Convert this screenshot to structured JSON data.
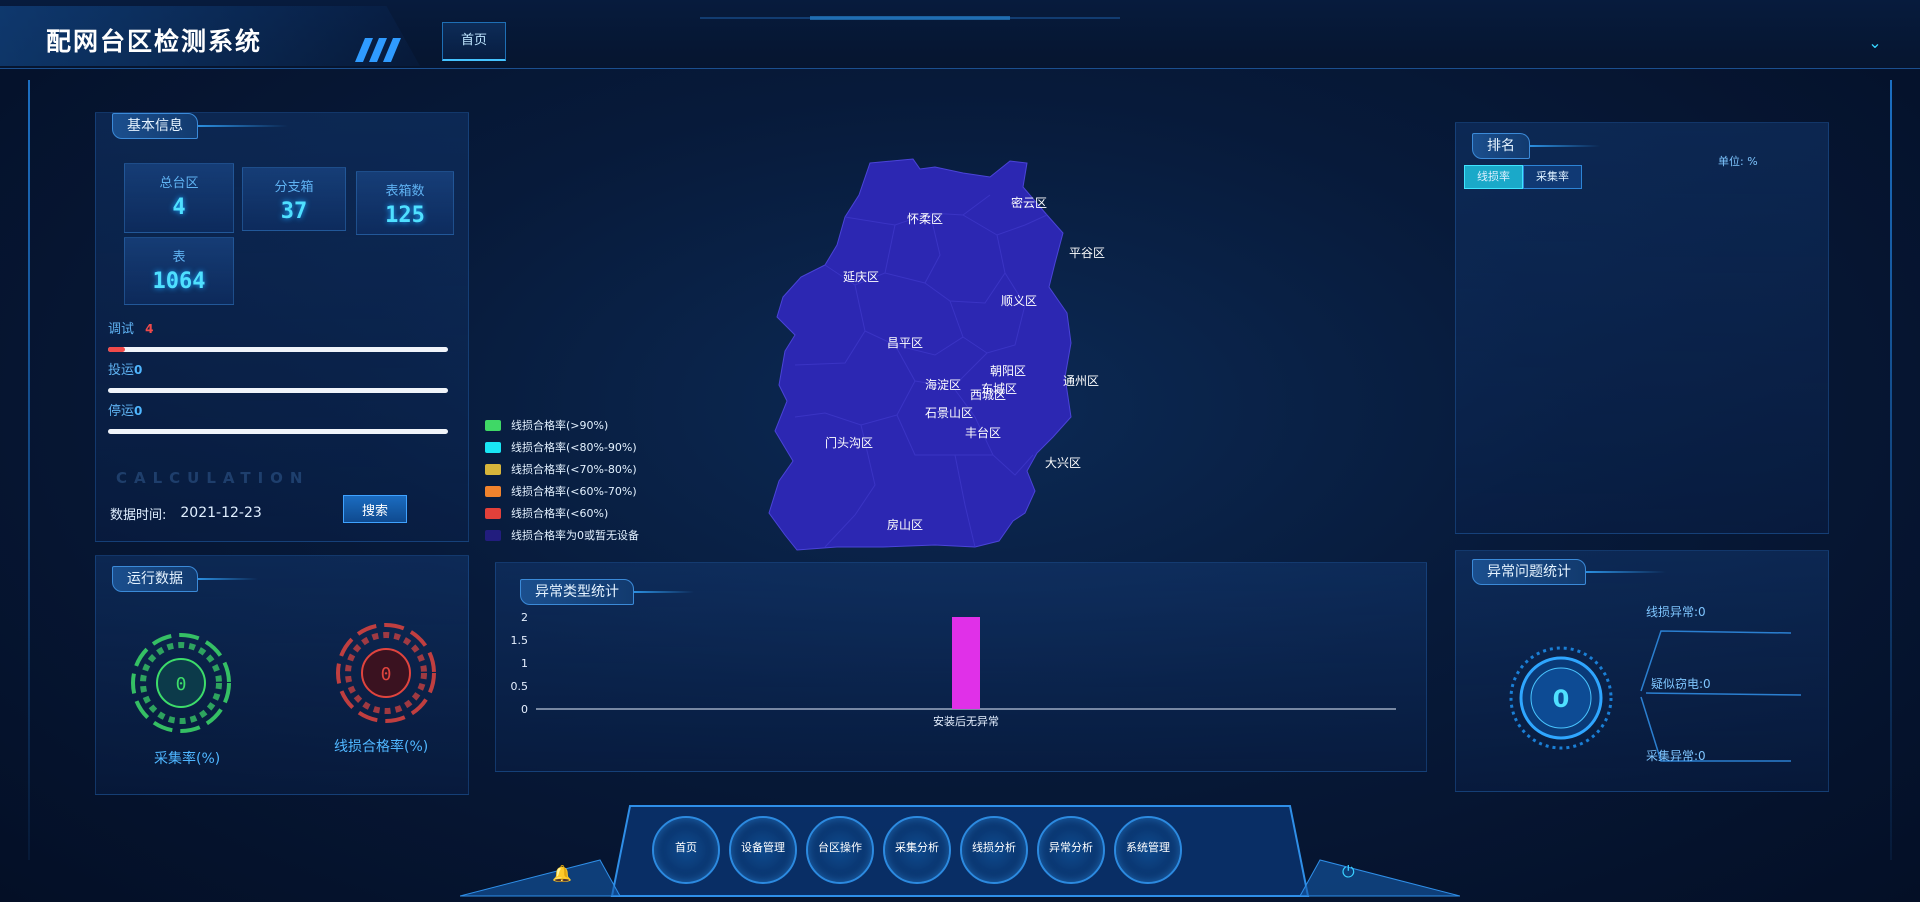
{
  "app": {
    "title": "配网台区检测系统"
  },
  "tabs": [
    {
      "label": "首页"
    }
  ],
  "basic_info": {
    "title": "基本信息",
    "stats": [
      {
        "label": "总台区",
        "value": "4"
      },
      {
        "label": "分支箱",
        "value": "37"
      },
      {
        "label": "表箱数",
        "value": "125"
      },
      {
        "label": "表",
        "value": "1064"
      }
    ],
    "progress": [
      {
        "label": "调试",
        "value": "4",
        "fraction": 0.05,
        "color": "#f04a4a"
      },
      {
        "label": "投运",
        "value": "0",
        "fraction": 0,
        "color": "#4fb6ff"
      },
      {
        "label": "停运",
        "value": "0",
        "fraction": 0,
        "color": "#4fb6ff"
      }
    ],
    "watermark": "CALCULATION",
    "date_label": "数据时间:",
    "date_value": "2021-12-23",
    "search_label": "搜索"
  },
  "run_data": {
    "title": "运行数据",
    "gauges": [
      {
        "label": "采集率(%)",
        "value": "0",
        "color": "#3ddc6a"
      },
      {
        "label": "线损合格率(%)",
        "value": "0",
        "color": "#e0443e"
      }
    ]
  },
  "map": {
    "districts": [
      "怀柔区",
      "密云区",
      "延庆区",
      "平谷区",
      "顺义区",
      "昌平区",
      "朝阳区",
      "海淀区",
      "东城区",
      "西城区",
      "通州区",
      "石景山区",
      "丰台区",
      "门头沟区",
      "大兴区",
      "房山区"
    ],
    "fill_color": "#2c27b2",
    "legend": [
      {
        "label": "线损合格率(>90%)",
        "color": "#3fd866"
      },
      {
        "label": "线损合格率(<80%-90%)",
        "color": "#19e6f5"
      },
      {
        "label": "线损合格率(<70%-80%)",
        "color": "#d7b53b"
      },
      {
        "label": "线损合格率(<60%-70%)",
        "color": "#f0832d"
      },
      {
        "label": "线损合格率(<60%)",
        "color": "#e2403a"
      },
      {
        "label": "线损合格率为0或暂无设备",
        "color": "#221d7e"
      }
    ]
  },
  "anomaly_chart": {
    "title": "异常类型统计"
  },
  "chart_data": {
    "type": "bar",
    "categories": [
      "安装后无异常"
    ],
    "values": [
      2
    ],
    "ylim": [
      0,
      2
    ],
    "yticks": [
      0,
      0.5,
      1,
      1.5,
      2
    ],
    "bar_color": "#e030e8",
    "grid": false
  },
  "ranking": {
    "title": "排名",
    "tabs": [
      {
        "label": "线损率"
      },
      {
        "label": "采集率"
      }
    ],
    "unit": "单位: %"
  },
  "anomaly_stats": {
    "title": "异常问题统计",
    "total": "0",
    "items": [
      {
        "label": "线损异常:0"
      },
      {
        "label": "疑似窃电:0"
      },
      {
        "label": "采集异常:0"
      }
    ]
  },
  "bottom_nav": [
    {
      "label": "首页"
    },
    {
      "label": "设备管理"
    },
    {
      "label": "台区操作"
    },
    {
      "label": "采集分析"
    },
    {
      "label": "线损分析"
    },
    {
      "label": "异常分析"
    },
    {
      "label": "系统管理"
    }
  ],
  "colors": {
    "accent": "#2c8ae0",
    "glow": "#4fe0ff",
    "bg": "#071a3a"
  }
}
